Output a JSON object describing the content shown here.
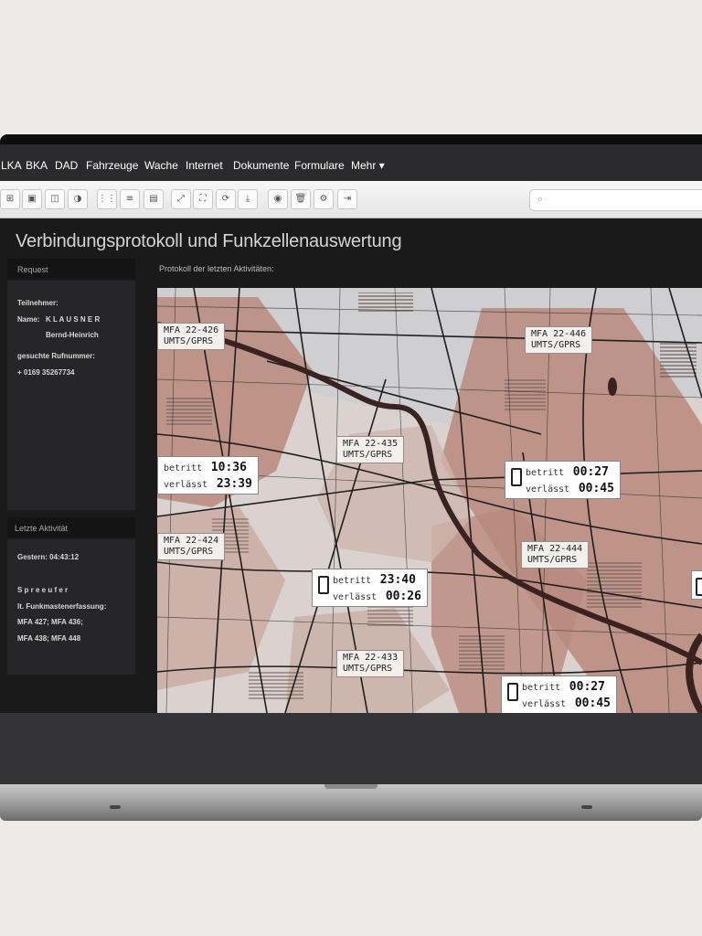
{
  "menu": {
    "items": [
      "LKA",
      "BKA",
      "DAD",
      "Fahrzeuge",
      "Wache",
      "Internet",
      "Dokumente",
      "Formulare",
      "Mehr ▾"
    ]
  },
  "toolbar": {
    "icons": [
      "grid-icon",
      "chart-icon",
      "image-icon",
      "contrast-icon",
      "apps-icon",
      "list-icon",
      "clipboard-icon",
      "expand-icon",
      "fullscreen-icon",
      "refresh-icon",
      "download-icon",
      "fingerprint-icon",
      "trash-icon",
      "settings-icon",
      "logout-icon"
    ],
    "glyphs": [
      "⊞",
      "▣",
      "◫",
      "◑",
      "⋮⋮",
      "≡",
      "▤",
      "⤢",
      "⛶",
      "⟳",
      "⤓",
      "◉",
      "🗑",
      "⚙",
      "⇥"
    ],
    "search_glyph": "⌕"
  },
  "page": {
    "title": "Verbindungsprotokoll und Funkzellenauswertung"
  },
  "request": {
    "heading": "Request",
    "participant_label": "Teilnehmer:",
    "name_label": "Name:",
    "surname": "K L A U S N E R",
    "firstname": "Bernd-Heinrich",
    "number_label": "gesuchte Rufnummer:",
    "number": "+ 0169 35267734"
  },
  "last_activity": {
    "heading": "Letzte Aktivität",
    "time": "Gestern: 04:43:12",
    "place": "S p r e e u f e r",
    "method": "lt. Funkmastenerfassung:",
    "masts_1": "MFA 427; MFA 436;",
    "masts_2": "MFA 438; MFA 448"
  },
  "map": {
    "label": "Protokoll der letzten Aktivitäten:",
    "cells": [
      {
        "id": "MFA 22-426",
        "type": "UMTS/GPRS"
      },
      {
        "id": "MFA 22-446",
        "type": "UMTS/GPRS"
      },
      {
        "id": "MFA 22-435",
        "type": "UMTS/GPRS"
      },
      {
        "id": "MFA 22-424",
        "type": "UMTS/GPRS"
      },
      {
        "id": "MFA 22-444",
        "type": "UMTS/GPRS"
      },
      {
        "id": "MFA 22-433",
        "type": "UMTS/GPRS"
      }
    ],
    "activities": [
      {
        "enter_label": "betritt",
        "enter": "10:36",
        "leave_label": "verlässt",
        "leave": "23:39"
      },
      {
        "enter_label": "betritt",
        "enter": "00:27",
        "leave_label": "verlässt",
        "leave": "00:45"
      },
      {
        "enter_label": "betritt",
        "enter": "23:40",
        "leave_label": "verlässt",
        "leave": "00:26"
      },
      {
        "enter_label": "betritt",
        "enter": "00:27",
        "leave_label": "verlässt",
        "leave": "00:45"
      }
    ],
    "colors": {
      "zone": "#b98a7d",
      "zone_light": "#c9b1a8",
      "river": "#3a2220",
      "base": "#dcd7d4",
      "road": "#1e1e1e"
    }
  }
}
